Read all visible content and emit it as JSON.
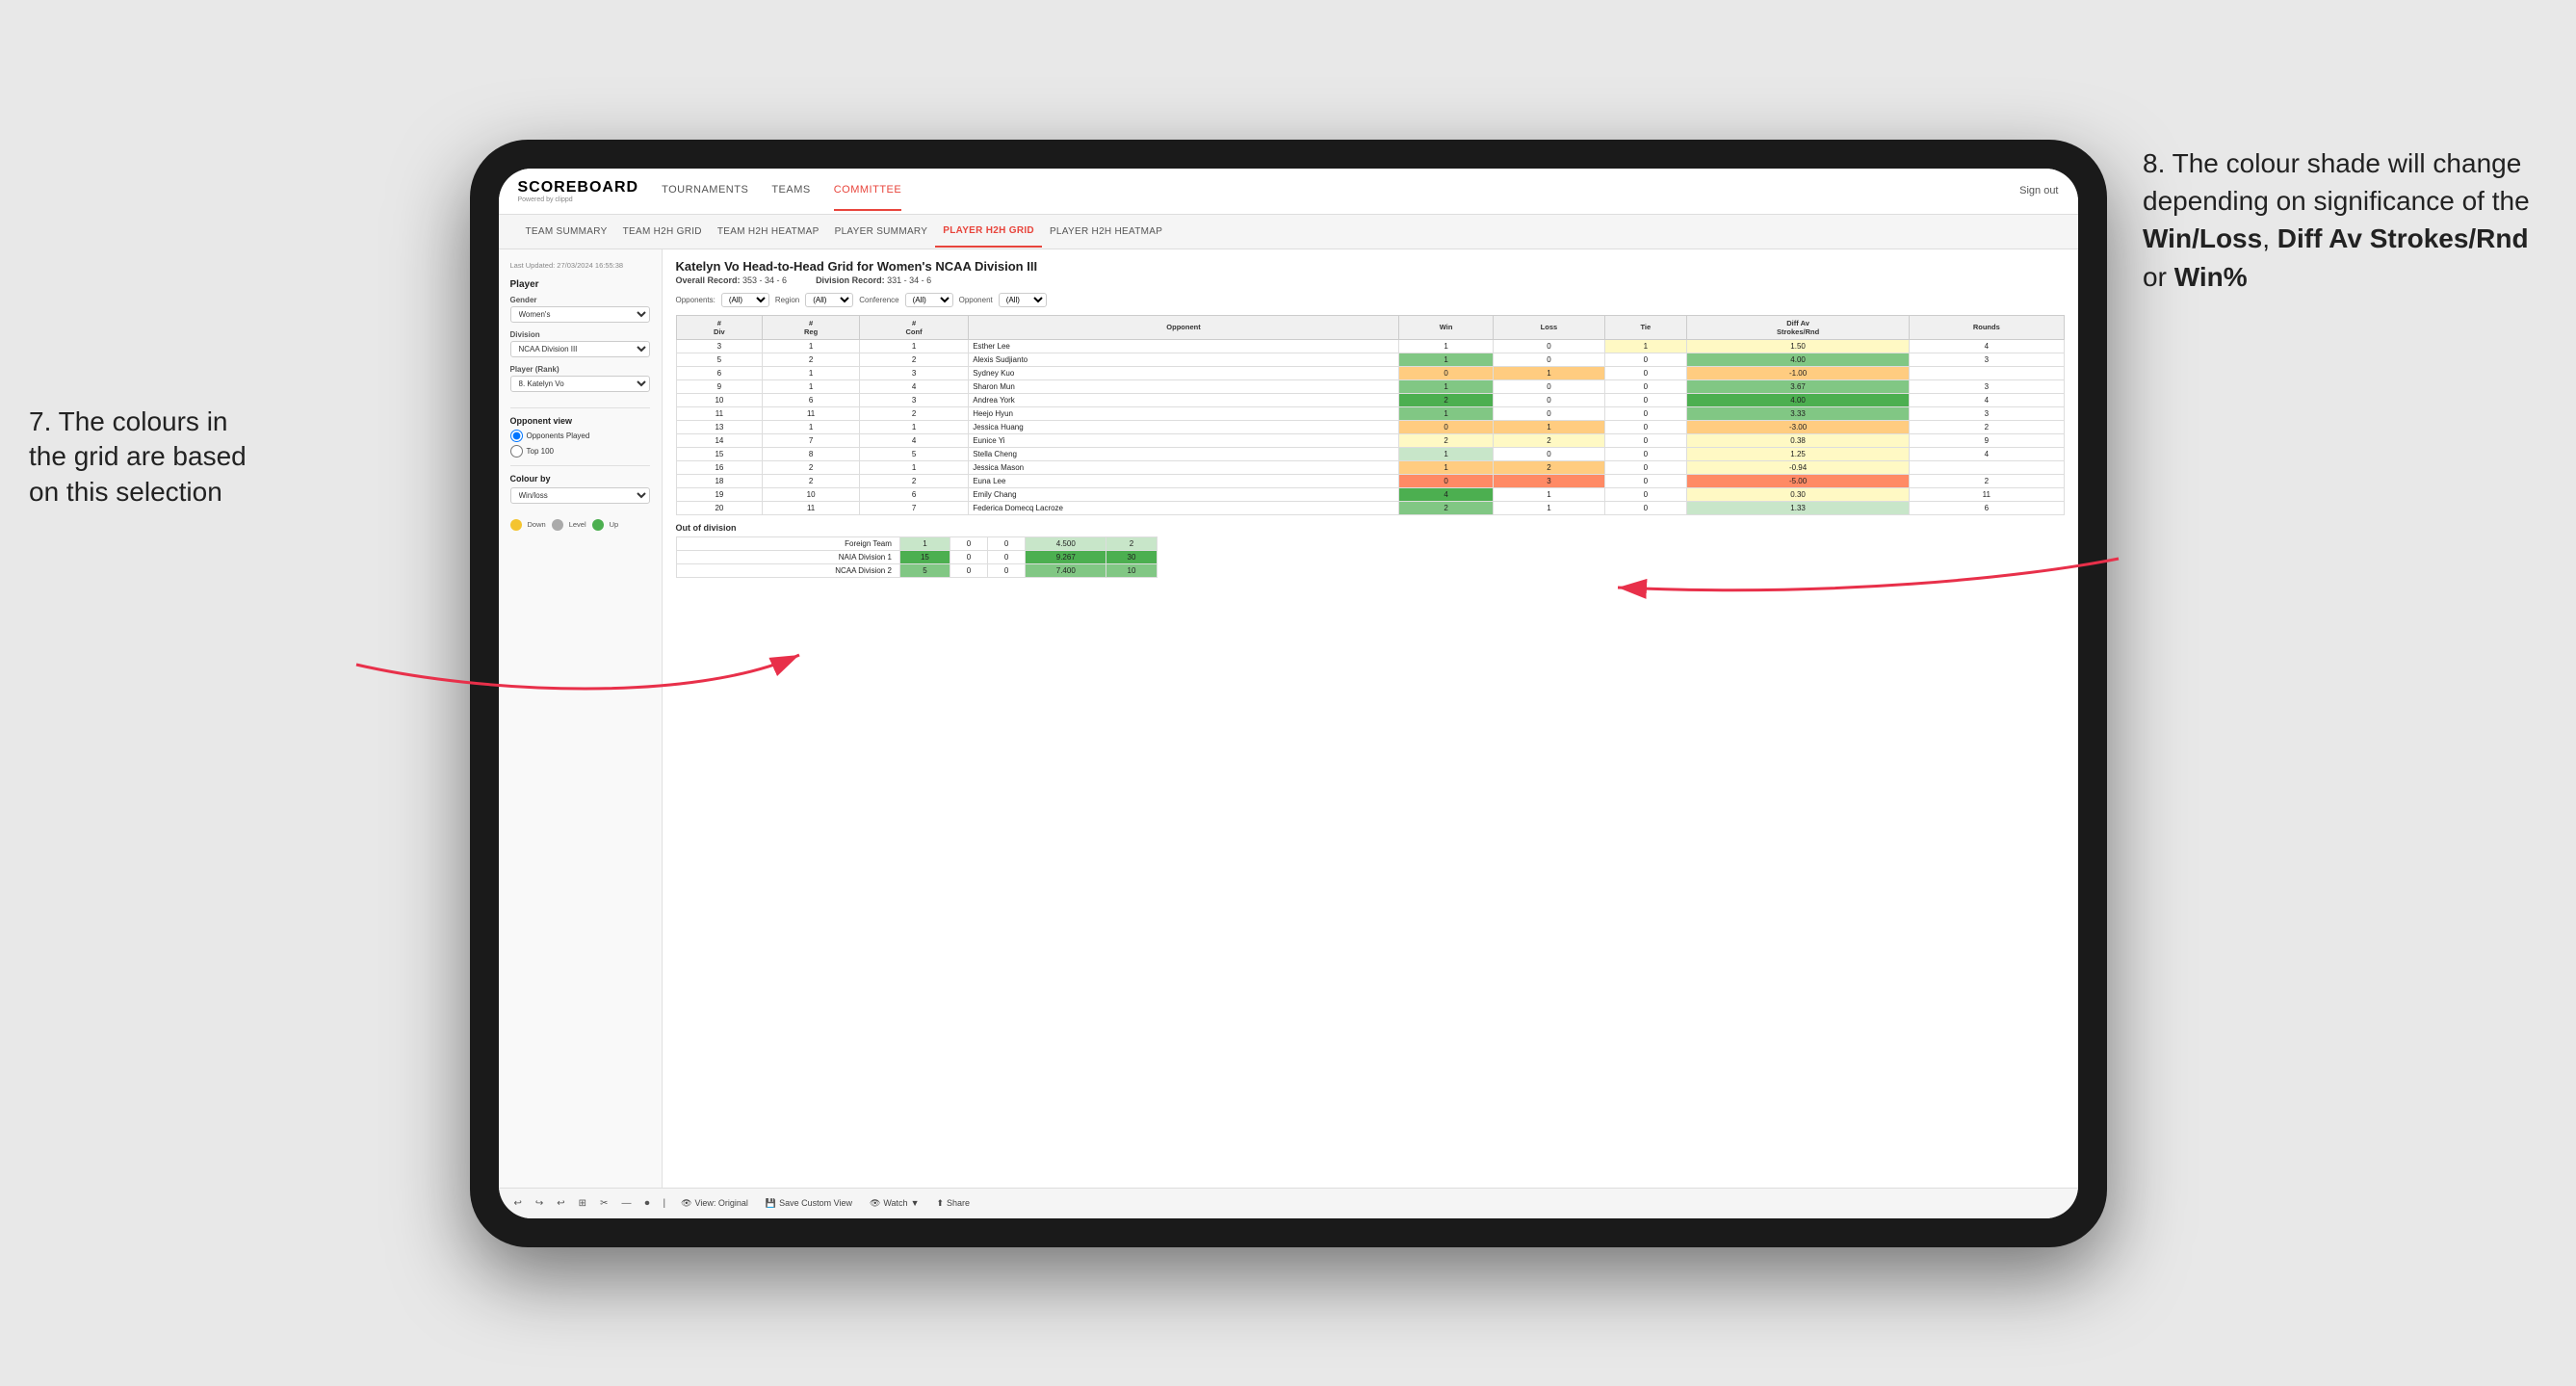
{
  "annotations": {
    "left": {
      "line1": "7. The colours in",
      "line2": "the grid are based",
      "line3": "on this selection"
    },
    "right": {
      "intro": "8. The colour shade will change depending on significance of the ",
      "bold1": "Win/Loss",
      "sep1": ", ",
      "bold2": "Diff Av Strokes/Rnd",
      "sep2": " or ",
      "bold3": "Win%"
    }
  },
  "nav": {
    "logo": "SCOREBOARD",
    "logo_sub": "Powered by clippd",
    "links": [
      "TOURNAMENTS",
      "TEAMS",
      "COMMITTEE"
    ],
    "active_link": "COMMITTEE",
    "sign_out": "Sign out"
  },
  "sub_nav": {
    "links": [
      "TEAM SUMMARY",
      "TEAM H2H GRID",
      "TEAM H2H HEATMAP",
      "PLAYER SUMMARY",
      "PLAYER H2H GRID",
      "PLAYER H2H HEATMAP"
    ],
    "active": "PLAYER H2H GRID"
  },
  "sidebar": {
    "timestamp": "Last Updated: 27/03/2024 16:55:38",
    "player_section": "Player",
    "gender_label": "Gender",
    "gender_value": "Women's",
    "division_label": "Division",
    "division_value": "NCAA Division III",
    "player_rank_label": "Player (Rank)",
    "player_rank_value": "8. Katelyn Vo",
    "opponent_view_title": "Opponent view",
    "radio_options": [
      "Opponents Played",
      "Top 100"
    ],
    "radio_selected": "Opponents Played",
    "colour_by_title": "Colour by",
    "colour_by_value": "Win/loss",
    "legend": [
      {
        "color": "#f4c430",
        "label": "Down"
      },
      {
        "color": "#aaa",
        "label": "Level"
      },
      {
        "color": "#4caf50",
        "label": "Up"
      }
    ]
  },
  "grid": {
    "title": "Katelyn Vo Head-to-Head Grid for Women's NCAA Division III",
    "overall_record_label": "Overall Record:",
    "overall_record": "353 - 34 - 6",
    "division_record_label": "Division Record:",
    "division_record": "331 - 34 - 6",
    "filter_opponents_label": "Opponents:",
    "filter_region_label": "Region",
    "filter_conference_label": "Conference",
    "filter_opponent_label": "Opponent",
    "filter_opponents_value": "(All)",
    "filter_region_value": "(All)",
    "filter_conference_value": "(All)",
    "filter_opponent_value": "(All)",
    "table_headers": [
      "#\nDiv",
      "#\nReg",
      "#\nConf",
      "Opponent",
      "Win",
      "Loss",
      "Tie",
      "Diff Av\nStrokes/Rnd",
      "Rounds"
    ],
    "rows": [
      {
        "div": 3,
        "reg": 1,
        "conf": 1,
        "opponent": "Esther Lee",
        "win": 1,
        "loss": 0,
        "tie": 1,
        "diff": 1.5,
        "rounds": 4,
        "win_color": "white",
        "diff_color": "yellow"
      },
      {
        "div": 5,
        "reg": 2,
        "conf": 2,
        "opponent": "Alexis Sudjianto",
        "win": 1,
        "loss": 0,
        "tie": 0,
        "diff": 4.0,
        "rounds": 3,
        "win_color": "green_med",
        "diff_color": "green_med"
      },
      {
        "div": 6,
        "reg": 1,
        "conf": 3,
        "opponent": "Sydney Kuo",
        "win": 0,
        "loss": 1,
        "tie": 0,
        "diff": -1.0,
        "rounds": "",
        "win_color": "orange",
        "diff_color": "orange"
      },
      {
        "div": 9,
        "reg": 1,
        "conf": 4,
        "opponent": "Sharon Mun",
        "win": 1,
        "loss": 0,
        "tie": 0,
        "diff": 3.67,
        "rounds": 3,
        "win_color": "green_med",
        "diff_color": "green_med"
      },
      {
        "div": 10,
        "reg": 6,
        "conf": 3,
        "opponent": "Andrea York",
        "win": 2,
        "loss": 0,
        "tie": 0,
        "diff": 4.0,
        "rounds": 4,
        "win_color": "green_dark",
        "diff_color": "green_dark"
      },
      {
        "div": 11,
        "reg": 11,
        "conf": 2,
        "opponent": "Heejo Hyun",
        "win": 1,
        "loss": 0,
        "tie": 0,
        "diff": 3.33,
        "rounds": 3,
        "win_color": "green_med",
        "diff_color": "green_med"
      },
      {
        "div": 13,
        "reg": 1,
        "conf": 1,
        "opponent": "Jessica Huang",
        "win": 0,
        "loss": 1,
        "tie": 0,
        "diff": -3.0,
        "rounds": 2,
        "win_color": "orange",
        "diff_color": "orange"
      },
      {
        "div": 14,
        "reg": 7,
        "conf": 4,
        "opponent": "Eunice Yi",
        "win": 2,
        "loss": 2,
        "tie": 0,
        "diff": 0.38,
        "rounds": 9,
        "win_color": "yellow",
        "diff_color": "yellow"
      },
      {
        "div": 15,
        "reg": 8,
        "conf": 5,
        "opponent": "Stella Cheng",
        "win": 1,
        "loss": 0,
        "tie": 0,
        "diff": 1.25,
        "rounds": 4,
        "win_color": "green_light",
        "diff_color": "yellow"
      },
      {
        "div": 16,
        "reg": 2,
        "conf": 1,
        "opponent": "Jessica Mason",
        "win": 1,
        "loss": 2,
        "tie": 0,
        "diff": -0.94,
        "rounds": "",
        "win_color": "orange_light",
        "diff_color": "yellow"
      },
      {
        "div": 18,
        "reg": 2,
        "conf": 2,
        "opponent": "Euna Lee",
        "win": 0,
        "loss": 3,
        "tie": 0,
        "diff": -5.0,
        "rounds": 2,
        "win_color": "orange_dark",
        "diff_color": "orange_dark"
      },
      {
        "div": 19,
        "reg": 10,
        "conf": 6,
        "opponent": "Emily Chang",
        "win": 4,
        "loss": 1,
        "tie": 0,
        "diff": 0.3,
        "rounds": 11,
        "win_color": "green_dark",
        "diff_color": "yellow"
      },
      {
        "div": 20,
        "reg": 11,
        "conf": 7,
        "opponent": "Federica Domecq Lacroze",
        "win": 2,
        "loss": 1,
        "tie": 0,
        "diff": 1.33,
        "rounds": 6,
        "win_color": "green_med",
        "diff_color": "green_light"
      }
    ],
    "out_of_division_title": "Out of division",
    "out_of_division_rows": [
      {
        "label": "Foreign Team",
        "win": 1,
        "loss": 0,
        "tie": 0,
        "diff": 4.5,
        "rounds": 2
      },
      {
        "label": "NAIA Division 1",
        "win": 15,
        "loss": 0,
        "tie": 0,
        "diff": 9.267,
        "rounds": 30
      },
      {
        "label": "NCAA Division 2",
        "win": 5,
        "loss": 0,
        "tie": 0,
        "diff": 7.4,
        "rounds": 10
      }
    ]
  },
  "toolbar": {
    "buttons": [
      "↩",
      "↩",
      "↩",
      "⊡",
      "✂",
      "·",
      "⏺",
      "·"
    ],
    "view_label": "View: Original",
    "save_custom": "Save Custom View",
    "watch": "Watch",
    "share": "Share"
  }
}
